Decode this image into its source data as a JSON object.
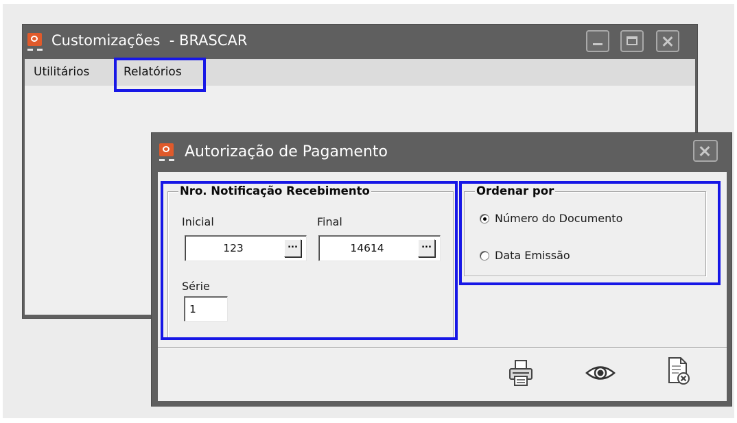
{
  "main_window": {
    "title": "Customizações  - BRASCAR",
    "menu": [
      {
        "label": "Utilitários"
      },
      {
        "label": "Relatórios"
      }
    ],
    "highlighted_menu": "Relatórios"
  },
  "dialog": {
    "title": "Autorização de Pagamento",
    "notification_group": {
      "legend": "Nro. Notificação Recebimento",
      "inicial_label": "Inicial",
      "inicial_value": "123",
      "final_label": "Final",
      "final_value": "14614",
      "lookup_button_label": "...",
      "serie_label": "Série",
      "serie_value": "1"
    },
    "order_group": {
      "legend": "Ordenar por",
      "options": [
        {
          "label": "Número do Documento",
          "selected": true
        },
        {
          "label": "Data Emissão",
          "selected": false
        }
      ]
    },
    "toolbar": {
      "buttons": [
        {
          "icon": "printer-icon"
        },
        {
          "icon": "eye-icon"
        },
        {
          "icon": "close-document-icon"
        }
      ]
    }
  },
  "colors": {
    "highlight": "#1717e6",
    "titlebar": "#5f5f5f",
    "app_icon": "#e05a2b"
  }
}
